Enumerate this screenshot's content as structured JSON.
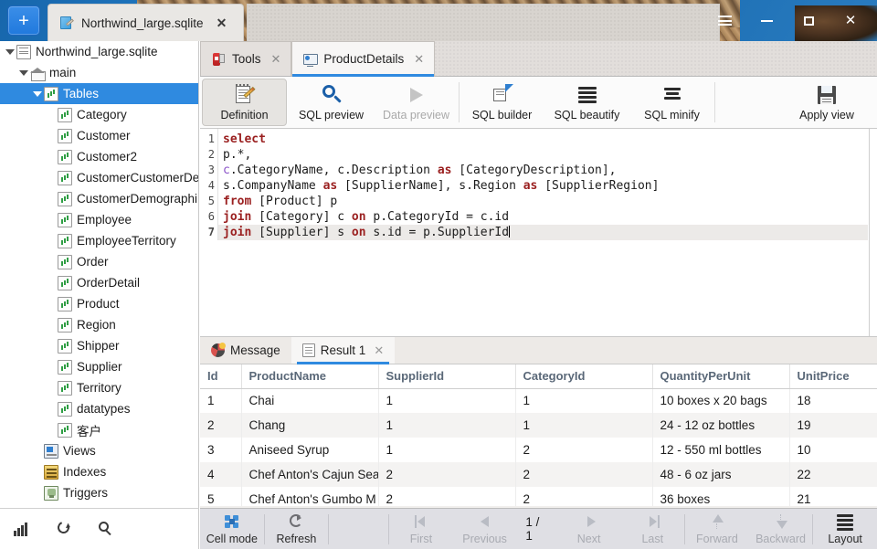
{
  "window": {
    "new_tab_label": "+",
    "document_tab": "Northwind_large.sqlite",
    "close_label": "✕",
    "menu_icon": "hamburger-icon",
    "minimize_icon": "minimize-icon",
    "maximize_icon": "maximize-icon",
    "close_icon": "close-icon"
  },
  "sidebar": {
    "nodes": [
      {
        "label": "Northwind_large.sqlite",
        "indent": 0,
        "caret": "down",
        "icon": "database-icon",
        "selected": false
      },
      {
        "label": "main",
        "indent": 1,
        "caret": "down",
        "icon": "home-icon",
        "selected": false
      },
      {
        "label": "Tables",
        "indent": 2,
        "caret": "down",
        "icon": "table-icon",
        "selected": true
      },
      {
        "label": "Category",
        "indent": 3,
        "caret": "none",
        "icon": "table-icon",
        "selected": false
      },
      {
        "label": "Customer",
        "indent": 3,
        "caret": "none",
        "icon": "table-icon",
        "selected": false
      },
      {
        "label": "Customer2",
        "indent": 3,
        "caret": "none",
        "icon": "table-icon",
        "selected": false
      },
      {
        "label": "CustomerCustomerDe",
        "indent": 3,
        "caret": "none",
        "icon": "table-icon",
        "selected": false
      },
      {
        "label": "CustomerDemographi",
        "indent": 3,
        "caret": "none",
        "icon": "table-icon",
        "selected": false
      },
      {
        "label": "Employee",
        "indent": 3,
        "caret": "none",
        "icon": "table-icon",
        "selected": false
      },
      {
        "label": "EmployeeTerritory",
        "indent": 3,
        "caret": "none",
        "icon": "table-icon",
        "selected": false
      },
      {
        "label": "Order",
        "indent": 3,
        "caret": "none",
        "icon": "table-icon",
        "selected": false
      },
      {
        "label": "OrderDetail",
        "indent": 3,
        "caret": "none",
        "icon": "table-icon",
        "selected": false
      },
      {
        "label": "Product",
        "indent": 3,
        "caret": "none",
        "icon": "table-icon",
        "selected": false
      },
      {
        "label": "Region",
        "indent": 3,
        "caret": "none",
        "icon": "table-icon",
        "selected": false
      },
      {
        "label": "Shipper",
        "indent": 3,
        "caret": "none",
        "icon": "table-icon",
        "selected": false
      },
      {
        "label": "Supplier",
        "indent": 3,
        "caret": "none",
        "icon": "table-icon",
        "selected": false
      },
      {
        "label": "Territory",
        "indent": 3,
        "caret": "none",
        "icon": "table-icon",
        "selected": false
      },
      {
        "label": "datatypes",
        "indent": 3,
        "caret": "none",
        "icon": "table-icon",
        "selected": false
      },
      {
        "label": "客户",
        "indent": 3,
        "caret": "none",
        "icon": "table-icon",
        "selected": false
      },
      {
        "label": "Views",
        "indent": 2,
        "caret": "right",
        "icon": "view-icon",
        "selected": false
      },
      {
        "label": "Indexes",
        "indent": 2,
        "caret": "right",
        "icon": "index-icon",
        "selected": false
      },
      {
        "label": "Triggers",
        "indent": 2,
        "caret": "right",
        "icon": "trigger-icon",
        "selected": false
      }
    ],
    "footer_icons": [
      "chart-icon",
      "refresh-icon",
      "search-icon"
    ]
  },
  "editor_tabs": [
    {
      "label": "Tools",
      "icon": "tools-icon",
      "active": false,
      "close": "✕"
    },
    {
      "label": "ProductDetails",
      "icon": "product-details-icon",
      "active": true,
      "close": "✕"
    }
  ],
  "toolbar": {
    "buttons": [
      {
        "label": "Definition",
        "icon": "definition-icon",
        "selected": true,
        "disabled": false
      },
      {
        "label": "SQL preview",
        "icon": "magnifier-icon",
        "selected": false,
        "disabled": false
      },
      {
        "label": "Data preview",
        "icon": "play-icon",
        "selected": false,
        "disabled": true
      },
      {
        "label": "SQL builder",
        "icon": "sql-builder-icon",
        "selected": false,
        "disabled": false
      },
      {
        "label": "SQL beautify",
        "icon": "sql-beautify-icon",
        "selected": false,
        "disabled": false
      },
      {
        "label": "SQL minify",
        "icon": "sql-minify-icon",
        "selected": false,
        "disabled": false
      }
    ],
    "apply_label": "Apply view",
    "apply_icon": "save-icon"
  },
  "editor": {
    "line_numbers": [
      "1",
      "2",
      "3",
      "4",
      "5",
      "6",
      "7"
    ],
    "current_line": 7,
    "lines": [
      [
        {
          "t": "select",
          "c": "kw"
        }
      ],
      [
        {
          "t": "p.*,",
          "c": ""
        }
      ],
      [
        {
          "t": "c",
          "c": "al"
        },
        {
          "t": ".CategoryName, c.Description ",
          "c": ""
        },
        {
          "t": "as",
          "c": "kw"
        },
        {
          "t": " [CategoryDescription],",
          "c": ""
        }
      ],
      [
        {
          "t": "s.CompanyName ",
          "c": ""
        },
        {
          "t": "as",
          "c": "kw"
        },
        {
          "t": " [SupplierName], s.Region ",
          "c": ""
        },
        {
          "t": "as",
          "c": "kw"
        },
        {
          "t": " [SupplierRegion]",
          "c": ""
        }
      ],
      [
        {
          "t": "from",
          "c": "kw"
        },
        {
          "t": " [Product] p",
          "c": ""
        }
      ],
      [
        {
          "t": "join",
          "c": "kw"
        },
        {
          "t": " [Category] c ",
          "c": ""
        },
        {
          "t": "on",
          "c": "kw"
        },
        {
          "t": " p.CategoryId = c.id",
          "c": ""
        }
      ],
      [
        {
          "t": "join",
          "c": "kw"
        },
        {
          "t": " [Supplier] s ",
          "c": ""
        },
        {
          "t": "on",
          "c": "kw"
        },
        {
          "t": " s.id = p.SupplierId",
          "c": ""
        }
      ]
    ]
  },
  "result_tabs": [
    {
      "label": "Message",
      "icon": "message-icon",
      "active": false,
      "closable": false
    },
    {
      "label": "Result 1",
      "icon": "result-icon",
      "active": true,
      "closable": true,
      "close": "✕"
    }
  ],
  "grid": {
    "columns": [
      "Id",
      "ProductName",
      "SupplierId",
      "CategoryId",
      "QuantityPerUnit",
      "UnitPrice"
    ],
    "rows": [
      [
        "1",
        "Chai",
        "1",
        "1",
        "10 boxes x 20 bags",
        "18"
      ],
      [
        "2",
        "Chang",
        "1",
        "1",
        "24 - 12 oz bottles",
        "19"
      ],
      [
        "3",
        "Aniseed Syrup",
        "1",
        "2",
        "12 - 550 ml bottles",
        "10"
      ],
      [
        "4",
        "Chef Anton's Cajun Sea",
        "2",
        "2",
        "48 - 6 oz jars",
        "22"
      ],
      [
        "5",
        "Chef Anton's Gumbo M",
        "2",
        "2",
        "36 boxes",
        "21"
      ]
    ],
    "numeric_columns": [
      0,
      2,
      3,
      5
    ]
  },
  "statusbar": {
    "buttons": [
      {
        "label": "Cell mode",
        "icon": "cell-mode-icon",
        "dim": false
      },
      {
        "label": "Refresh",
        "icon": "refresh-icon",
        "dim": false
      },
      {
        "label": "First",
        "icon": "first-icon",
        "dim": true
      },
      {
        "label": "Previous",
        "icon": "previous-icon",
        "dim": true
      }
    ],
    "page_indicator": "1 / 1",
    "buttons_right": [
      {
        "label": "Next",
        "icon": "next-icon",
        "dim": true
      },
      {
        "label": "Last",
        "icon": "last-icon",
        "dim": true
      },
      {
        "label": "Forward",
        "icon": "forward-icon",
        "dim": true
      },
      {
        "label": "Backward",
        "icon": "backward-icon",
        "dim": true
      },
      {
        "label": "Layout",
        "icon": "layout-icon",
        "dim": false
      }
    ]
  },
  "colors": {
    "accent": "#2f8ae0",
    "selection": "#2f8ae0",
    "keyword": "#9a1f1f",
    "numeric": "#d6272a",
    "header_text": "#5a6878",
    "titlebar": "#1766ab"
  }
}
